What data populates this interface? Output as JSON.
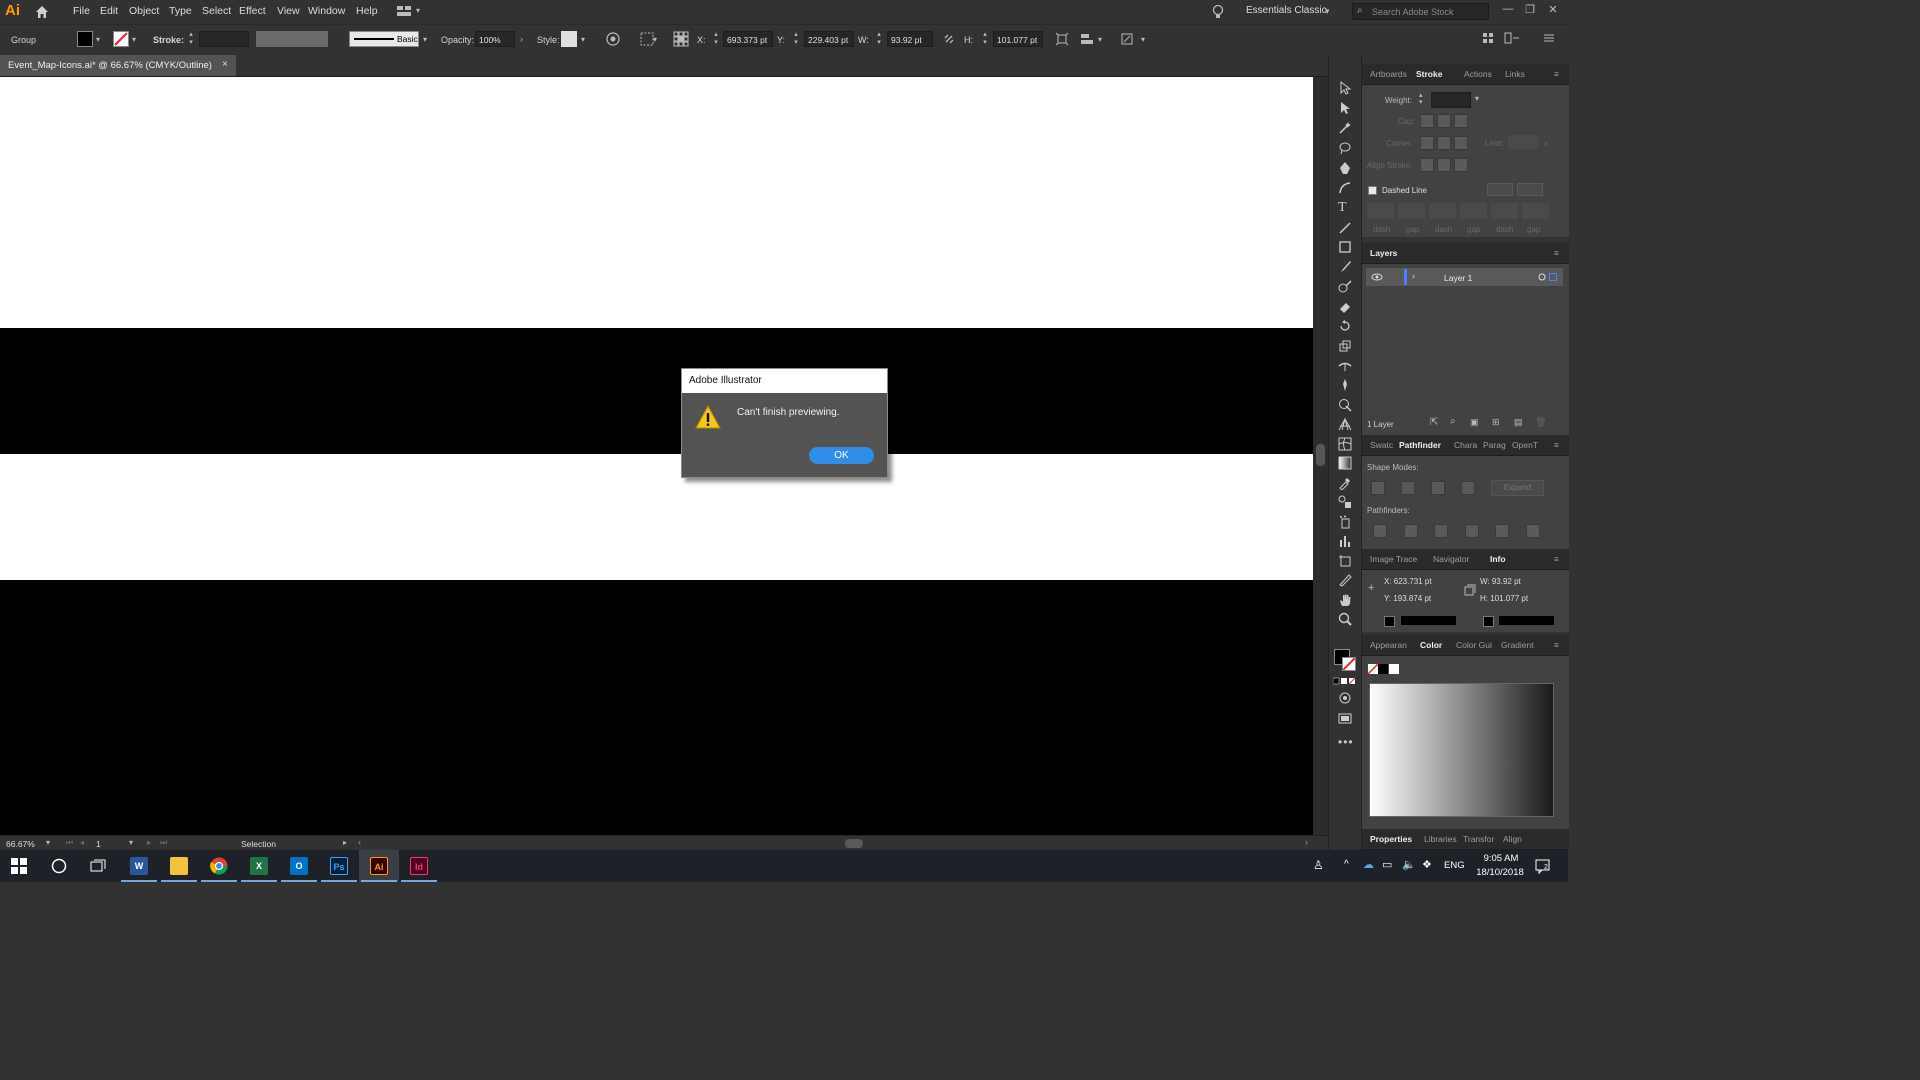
{
  "app": {
    "logo": "Ai",
    "menu": [
      "File",
      "Edit",
      "Object",
      "Type",
      "Select",
      "Effect",
      "View",
      "Window",
      "Help"
    ],
    "workspace": "Essentials Classic",
    "search_placeholder": "Search Adobe Stock"
  },
  "control_bar": {
    "selection_type": "Group",
    "stroke_label": "Stroke:",
    "brush_label": "Basic",
    "opacity_label": "Opacity:",
    "opacity_value": "100%",
    "style_label": "Style:",
    "x_label": "X:",
    "x_value": "693.373 pt",
    "y_label": "Y:",
    "y_value": "229.403 pt",
    "w_label": "W:",
    "w_value": "93.92 pt",
    "h_label": "H:",
    "h_value": "101.077 pt"
  },
  "document": {
    "tab_title": "Event_Map-Icons.ai* @ 66.67% (CMYK/Outline)",
    "close_glyph": "×"
  },
  "status_bar": {
    "zoom": "66.67%",
    "artboard": "1",
    "tool": "Selection"
  },
  "panels": {
    "top_tabs": [
      "Artboards",
      "Stroke",
      "Actions",
      "Links"
    ],
    "stroke": {
      "weight_label": "Weight:",
      "cap_label": "Cap:",
      "corner_label": "Corner:",
      "limit_label": "Limit:",
      "limit_suffix": "x",
      "align_label": "Align Stroke:",
      "dashed_label": "Dashed Line",
      "dash_labels": [
        "dash",
        "gap",
        "dash",
        "gap",
        "dash",
        "gap"
      ]
    },
    "layers": {
      "tab": "Layers",
      "layer_name": "Layer 1",
      "count": "1 Layer"
    },
    "mid_tabs": [
      "Swatc",
      "Pathfinder",
      "Chara",
      "Parag",
      "OpenT"
    ],
    "pathfinder": {
      "shape_modes_label": "Shape Modes:",
      "expand_label": "Expand",
      "pathfinders_label": "Pathfinders:"
    },
    "info_tabs": [
      "Image Trace",
      "Navigator",
      "Info"
    ],
    "info": {
      "x": "X: 623.731 pt",
      "y": "Y: 193.874 pt",
      "w": "W: 93.92 pt",
      "h": "H: 101.077 pt"
    },
    "color_tabs": [
      "Appearan",
      "Color",
      "Color Gui",
      "Gradient"
    ],
    "bottom_tabs": [
      "Properties",
      "Libraries",
      "Transfor",
      "Align"
    ]
  },
  "dialog": {
    "title": "Adobe Illustrator",
    "message": "Can't finish previewing.",
    "ok_label": "OK"
  },
  "taskbar": {
    "apps": [
      {
        "name": "Word",
        "label": "W",
        "color": "#2b579a"
      },
      {
        "name": "File Explorer",
        "label": "",
        "color": "#f3c340"
      },
      {
        "name": "Chrome",
        "label": "",
        "color": "#db4437"
      },
      {
        "name": "Excel",
        "label": "X",
        "color": "#217346"
      },
      {
        "name": "Outlook",
        "label": "O",
        "color": "#0072c6"
      },
      {
        "name": "Photoshop",
        "label": "Ps",
        "color": "#001e36"
      },
      {
        "name": "Illustrator",
        "label": "Ai",
        "color": "#330000"
      },
      {
        "name": "InDesign",
        "label": "Id",
        "color": "#49021f"
      }
    ],
    "language": "ENG",
    "time": "9:05 AM",
    "date": "18/10/2018",
    "notification_count": "2"
  }
}
